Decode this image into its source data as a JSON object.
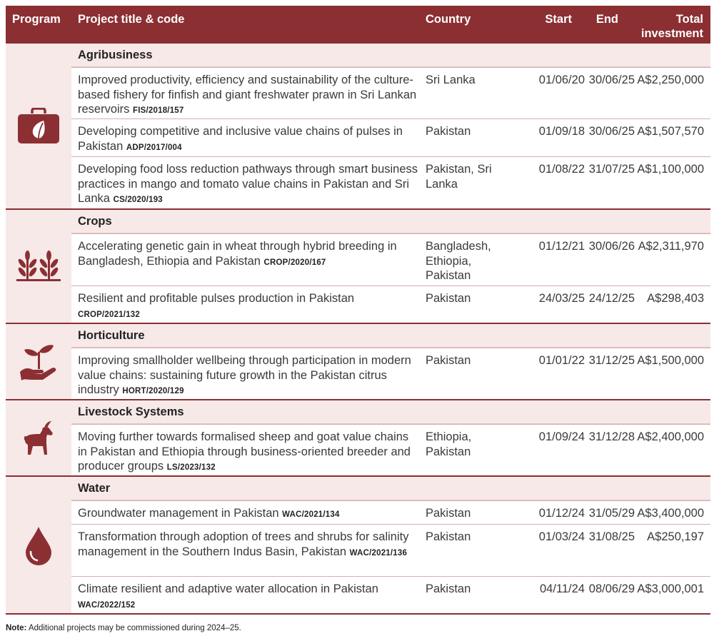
{
  "header": {
    "program": "Program",
    "title": "Project title & code",
    "country": "Country",
    "start": "Start",
    "end": "End",
    "investment_line1": "Total",
    "investment_line2": "investment"
  },
  "groups": [
    {
      "name": "Agribusiness",
      "icon": "briefcase-leaf-icon",
      "rows": [
        {
          "title": "Improved productivity, efficiency and sustainability of the culture-based fishery for finfish and giant freshwater prawn in Sri Lankan reservoirs",
          "code": "FIS/2018/157",
          "country": "Sri Lanka",
          "start": "01/06/20",
          "end": "30/06/25",
          "investment": "A$2,250,000"
        },
        {
          "title": "Developing competitive and inclusive value chains of pulses in Pakistan",
          "code": "ADP/2017/004",
          "country": "Pakistan",
          "start": "01/09/18",
          "end": "30/06/25",
          "investment": "A$1,507,570"
        },
        {
          "title": "Developing food loss reduction pathways through smart business practices in mango and tomato value chains in Pakistan and Sri Lanka",
          "code": "CS/2020/193",
          "country": "Pakistan, Sri Lanka",
          "start": "01/08/22",
          "end": "31/07/25",
          "investment": "A$1,100,000"
        }
      ]
    },
    {
      "name": "Crops",
      "icon": "wheat-plants-icon",
      "rows": [
        {
          "title": "Accelerating genetic gain in wheat through hybrid breeding in Bangladesh, Ethiopia and Pakistan",
          "code": "CROP/2020/167",
          "country": "Bangladesh, Ethiopia, Pakistan",
          "start": "01/12/21",
          "end": "30/06/26",
          "investment": "A$2,311,970"
        },
        {
          "title": "Resilient and profitable pulses production in Pakistan",
          "code": "CROP/2021/132",
          "country": "Pakistan",
          "start": "24/03/25",
          "end": "24/12/25",
          "investment": "A$298,403"
        }
      ]
    },
    {
      "name": "Horticulture",
      "icon": "hand-seedling-icon",
      "rows": [
        {
          "title": "Improving smallholder wellbeing through participation in modern value chains: sustaining future growth in the Pakistan citrus industry",
          "code": "HORT/2020/129",
          "country": "Pakistan",
          "start": "01/01/22",
          "end": "31/12/25",
          "investment": "A$1,500,000"
        }
      ]
    },
    {
      "name": "Livestock Systems",
      "icon": "goat-icon",
      "rows": [
        {
          "title": "Moving further towards formalised sheep and goat value chains in Pakistan and Ethiopia through business-oriented breeder and producer groups",
          "code": "LS/2023/132",
          "country": "Ethiopia, Pakistan",
          "start": "01/09/24",
          "end": "31/12/28",
          "investment": "A$2,400,000"
        }
      ]
    },
    {
      "name": "Water",
      "icon": "water-drop-icon",
      "rows": [
        {
          "title": "Groundwater management in Pakistan",
          "code": "WAC/2021/134",
          "country": "Pakistan",
          "start": "01/12/24",
          "end": "31/05/29",
          "investment": "A$3,400,000"
        },
        {
          "title": "Transformation through adoption of trees and shrubs for salinity management in the Southern Indus Basin, Pakistan",
          "code": "WAC/2021/136",
          "country": "Pakistan",
          "start": "01/03/24",
          "end": "31/08/25",
          "investment": "A$250,197"
        },
        {
          "title": "Climate resilient and adaptive water allocation in Pakistan",
          "code": "WAC/2022/152",
          "country": "Pakistan",
          "start": "04/11/24",
          "end": "08/06/29",
          "investment": "A$3,000,001"
        }
      ]
    }
  ],
  "note": {
    "label": "Note:",
    "text": "Additional projects may be commissioned during 2024–25."
  },
  "colors": {
    "header_bg": "#8c2f33",
    "band_bg": "#f6e9e8",
    "icon": "#8c2f33"
  }
}
